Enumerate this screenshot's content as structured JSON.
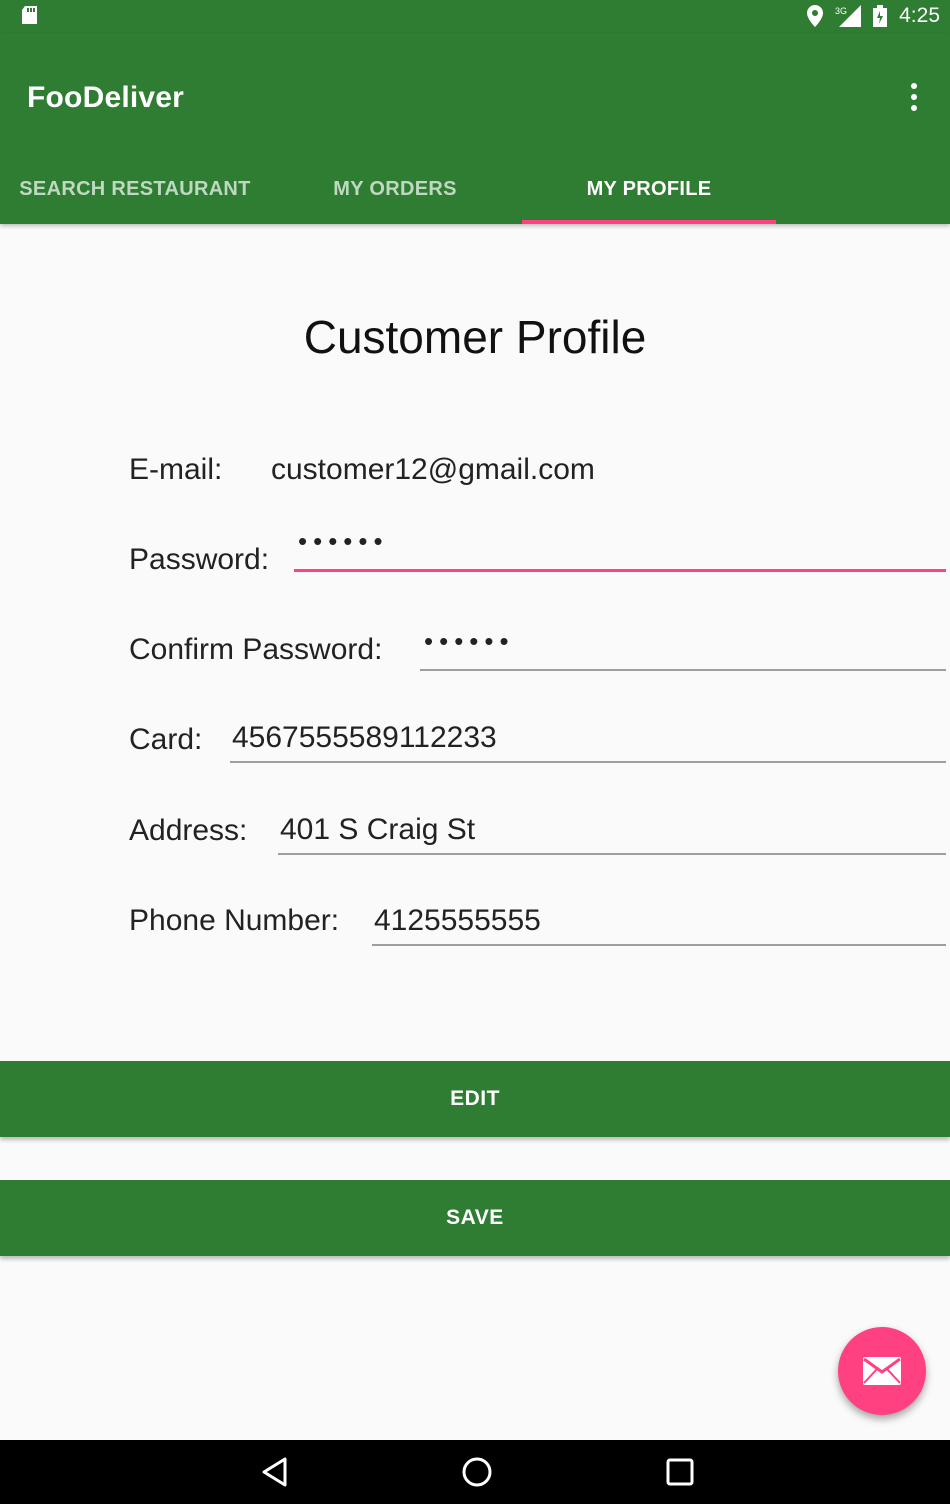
{
  "status_bar": {
    "time": "4:25",
    "network": "3G",
    "icons": [
      "sd-card-icon",
      "location-icon",
      "signal-icon",
      "battery-icon"
    ]
  },
  "app_bar": {
    "title": "FooDeliver",
    "menu_icon": "more-vert-icon"
  },
  "tabs": [
    {
      "label": "SEARCH RESTAURANT",
      "active": false
    },
    {
      "label": "MY ORDERS",
      "active": false
    },
    {
      "label": "MY PROFILE",
      "active": true
    }
  ],
  "profile": {
    "title": "Customer Profile",
    "email": {
      "label": "E-mail:",
      "value": "customer12@gmail.com"
    },
    "password": {
      "label": "Password:",
      "value": "••••••"
    },
    "confirm_password": {
      "label": "Confirm Password:",
      "value": "••••••"
    },
    "card": {
      "label": "Card:",
      "value": "4567555589112233"
    },
    "address": {
      "label": "Address:",
      "value": "401 S Craig St"
    },
    "phone": {
      "label": "Phone Number:",
      "value": "4125555555"
    }
  },
  "buttons": {
    "edit": "EDIT",
    "save": "SAVE"
  },
  "fab": {
    "icon": "email-icon"
  },
  "nav_bar": {
    "icons": [
      "back-icon",
      "home-icon",
      "recents-icon"
    ]
  },
  "colors": {
    "primary": "#2e7d32",
    "accent": "#ff4081",
    "background": "#fafafa"
  }
}
